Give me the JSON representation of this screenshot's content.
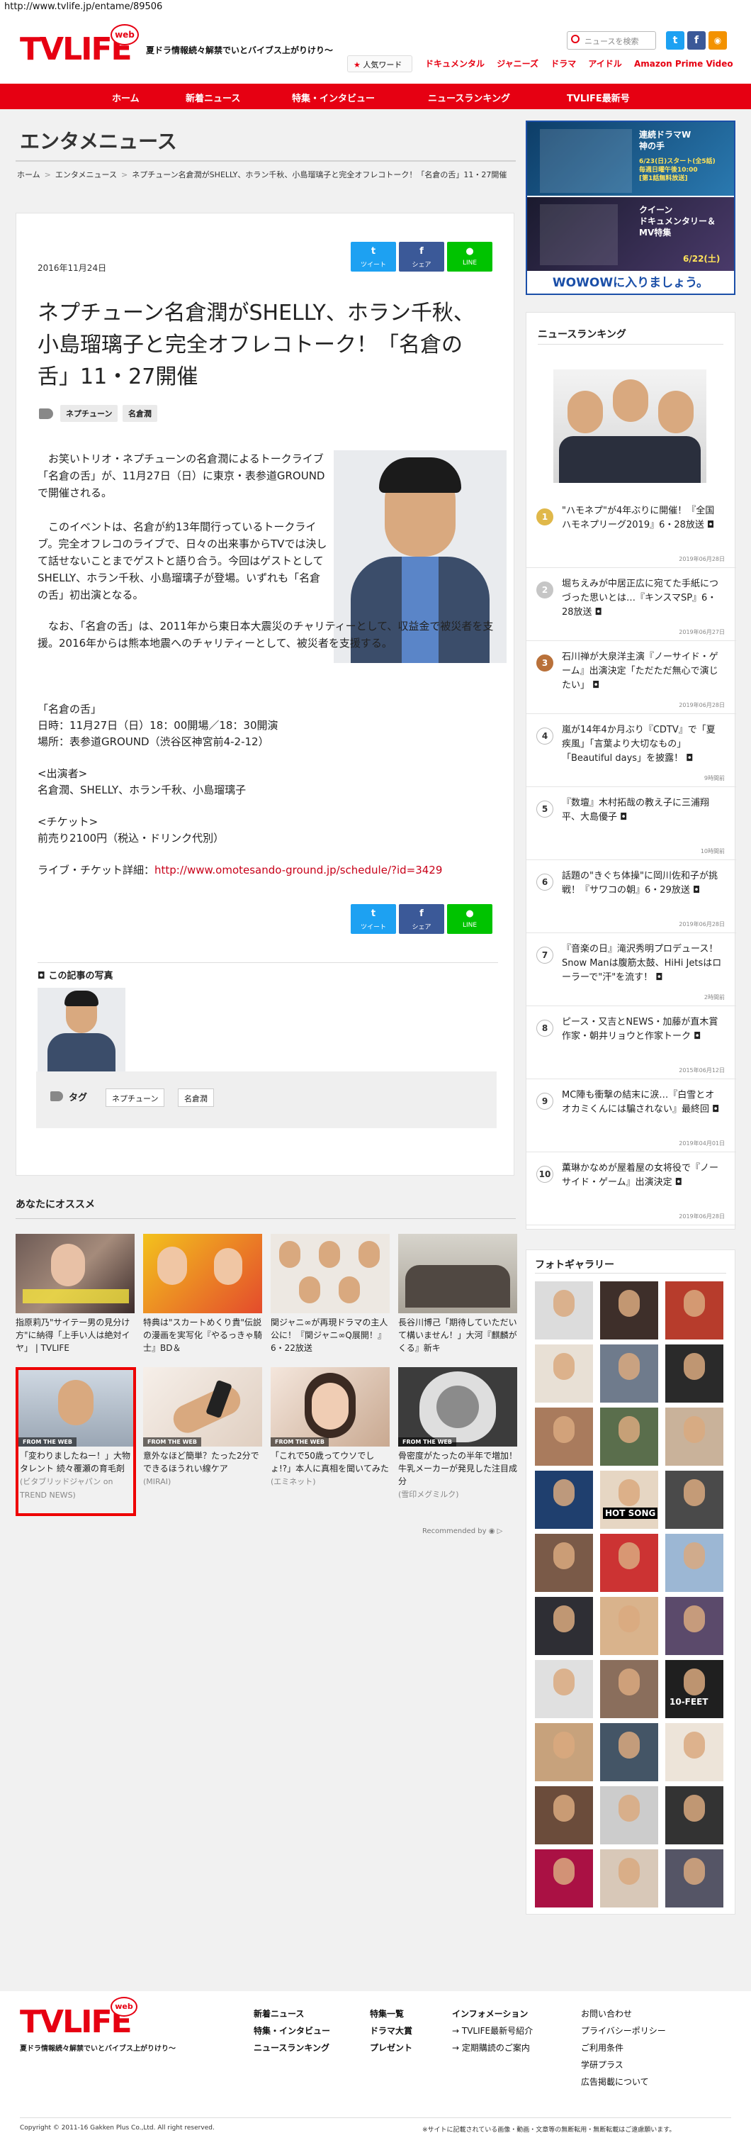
{
  "url": "http://www.tvlife.jp/entame/89506",
  "header": {
    "logo": "TVLIFE",
    "logo_web": "web",
    "logo_sub": "夏ドラ情報続々解禁でいとバイブス上がりけり〜",
    "tagline": "夏ドラ情報続々解禁でいとバイブス上がりけり〜",
    "search_placeholder": "ニュースを検索",
    "ninki_label": "人気ワード",
    "toplinks": [
      "ドキュメンタル",
      "ジャニーズ",
      "ドラマ",
      "アイドル",
      "Amazon Prime Video"
    ]
  },
  "nav": [
    "ホーム",
    "新着ニュース",
    "特集・インタビュー",
    "ニュースランキング",
    "TVLIFE最新号"
  ],
  "section_title": "エンタメニュース",
  "breadcrumb": {
    "home": "ホーム",
    "section": "エンタメニュース",
    "current": "ネプチューン名倉潤がSHELLY、ホラン千秋、小島瑠璃子と完全オフレコトーク！「名倉の舌」11・27開催"
  },
  "article": {
    "date": "2016年11月24日",
    "share": {
      "tweet": "ツイート",
      "facebook": "シェア",
      "line": "LINE"
    },
    "title": "ネプチューン名倉潤がSHELLY、ホラン千秋、小島瑠璃子と完全オフレコトーク！「名倉の舌」11・27開催",
    "tags": [
      "ネプチューン",
      "名倉潤"
    ],
    "p1": "お笑いトリオ・ネプチューンの名倉潤によるトークライブ「名倉の舌」が、11月27日（日）に東京・表参道GROUNDで開催される。",
    "p2": "このイベントは、名倉が約13年間行っているトークライブ。完全オフレコのライブで、日々の出来事からTVでは決して話せないことまでゲストと語り合う。今回はゲストとしてSHELLY、ホラン千秋、小島瑠璃子が登場。いずれも「名倉の舌」初出演となる。",
    "p3": "なお、「名倉の舌」は、2011年から東日本大震災のチャリティーとして、収益金で被災者を支援。2016年からは熊本地震へのチャリティーとして、被災者を支援する。",
    "info_title": "「名倉の舌」",
    "info_date": "日時：11月27日（日）18：00開場／18：30開演",
    "info_place": "場所：表参道GROUND（渋谷区神宮前4-2-12）",
    "cast_title": "<出演者>",
    "cast": "名倉潤、SHELLY、ホラン千秋、小島瑠璃子",
    "ticket_title": "<チケット>",
    "ticket": "前売り2100円（税込・ドリンク代別）",
    "live_label": "ライブ・チケット詳細：",
    "live_url": "http://www.omotesando-ground.jp/schedule/?id=3429",
    "photos_title": "この記事の写真",
    "tag_label": "タグ"
  },
  "recommend": {
    "title": "あなたにオススメ",
    "items": [
      {
        "caption": "指原莉乃\"サイテー男の見分け方\"に納得「上手い人は絶対イヤ」 | TVLIFE",
        "from_web": "",
        "source": ""
      },
      {
        "caption": "特典は\"スカートめくり貴\"伝説の漫画を実写化『やるっきゃ騎士』BD＆",
        "from_web": "",
        "source": ""
      },
      {
        "caption": "関ジャニ∞が再現ドラマの主人公に！『関ジャニ∞Q展開！』6・22放送",
        "from_web": "",
        "source": ""
      },
      {
        "caption": "長谷川博己「期待していただいて構いません！」大河『麒麟がくる』新キ",
        "from_web": "",
        "source": ""
      },
      {
        "caption": "「変わりましたねー！」大物タレント 続々覆瀬の育毛剤",
        "from_web": "FROM THE WEB",
        "source": "(ビタブリッドジャパン on TREND NEWS)"
      },
      {
        "caption": "意外なほど簡単？たった2分でできるほうれい線ケア",
        "from_web": "FROM THE WEB",
        "source": "(MIRAI)"
      },
      {
        "caption": "「これで50歳ってウソでしょ!?」本人に真相を聞いてみた",
        "from_web": "FROM THE WEB",
        "source": "(エミネット)"
      },
      {
        "caption": "骨密度がたったの半年で増加！牛乳メーカーが発見した注目成分",
        "from_web": "FROM THE WEB",
        "source": "(雪印メグミルク)"
      }
    ],
    "recommended_by": "Recommended by"
  },
  "sidebar": {
    "ad1_title": "連続ドラマW\n神の手",
    "ad1_date": "6/23(日)スタート(全5話)\n毎週日曜午後10:00\n[第1話無料放送]",
    "ad2_title": "クイーン\nドキュメンタリー＆\nMV特集",
    "ad2_date": "6/22(土)",
    "ad_banner": "WOWOWに入りましょう。",
    "ranking_title": "ニュースランキング",
    "ranking": [
      {
        "num": "1",
        "text": "\"ハモネプ\"が4年ぶりに開催！『全国ハモネプリーグ2019』6・28放送",
        "date": "2019年06月28日",
        "color": "#e0b84a"
      },
      {
        "num": "2",
        "text": "堀ちえみが中居正広に宛てた手紙につづった思いとは…『キンスマSP』6・28放送",
        "date": "2019年06月27日",
        "color": "#c6c6c6"
      },
      {
        "num": "3",
        "text": "石川禅が大泉洋主演『ノーサイド・ゲーム』出演決定「ただただ無心で演じたい」",
        "date": "2019年06月28日",
        "color": "#b9713a"
      },
      {
        "num": "4",
        "text": "嵐が14年4か月ぶり『CDTV』で「夏疾風」「言葉より大切なもの」「Beautiful days」を披露！",
        "date": "9時間前",
        "color": ""
      },
      {
        "num": "5",
        "text": "『数壇』木村拓哉の教え子に三浦翔平、大島優子",
        "date": "10時間前",
        "color": ""
      },
      {
        "num": "6",
        "text": "話題の\"きぐち体操\"に岡川佐和子が挑戦！『サワコの朝』6・29放送",
        "date": "2019年06月28日",
        "color": ""
      },
      {
        "num": "7",
        "text": "『音楽の日』滝沢秀明プロデュース！Snow Manは腹筋太鼓、HiHi Jetsはローラーで\"汗\"を流す！",
        "date": "2時間前",
        "color": ""
      },
      {
        "num": "8",
        "text": "ピース・又吉とNEWS・加藤が直木賞作家・朝井リョウと作家トーク",
        "date": "2015年06月12日",
        "color": ""
      },
      {
        "num": "9",
        "text": "MC陣も衝撃の結末に涙…『白雪とオオカミくんには騙されない』最終回",
        "date": "2019年04月01日",
        "color": ""
      },
      {
        "num": "10",
        "text": "薫琳かなめが屋着屋の女将役で『ノーサイド・ゲーム』出演決定",
        "date": "2019年06月28日",
        "color": ""
      }
    ],
    "gallery_title": "フォトギャラリー",
    "gallery_labels": [
      "HOT SONG",
      "10-FEET"
    ]
  },
  "footer": {
    "logo": "TVLIFE",
    "logo_web": "web",
    "sub": "夏ドラ情報続々解禁でいとバイブス上がりけり〜",
    "col1": [
      "新着ニュース",
      "特集・インタビュー",
      "ニュースランキング"
    ],
    "col2": [
      "特集一覧",
      "ドラマ大賞",
      "プレゼント"
    ],
    "col3_title": "インフォメーション",
    "col3": [
      "TVLIFE最新号紹介",
      "定期購読のご案内"
    ],
    "col4": [
      "お問い合わせ",
      "プライバシーポリシー",
      "ご利用条件",
      "学研プラス",
      "広告掲載について"
    ],
    "copyright": "Copyright © 2011-16 Gakken Plus Co.,Ltd. All right reserved.",
    "notice": "※サイトに記載されている画像・動画・文章等の無断転用・無断転載はご遠慮願います。"
  },
  "colors": {
    "brand": "#e60012",
    "twitter": "#1da1f2",
    "facebook": "#3b5998",
    "line": "#00c300"
  }
}
